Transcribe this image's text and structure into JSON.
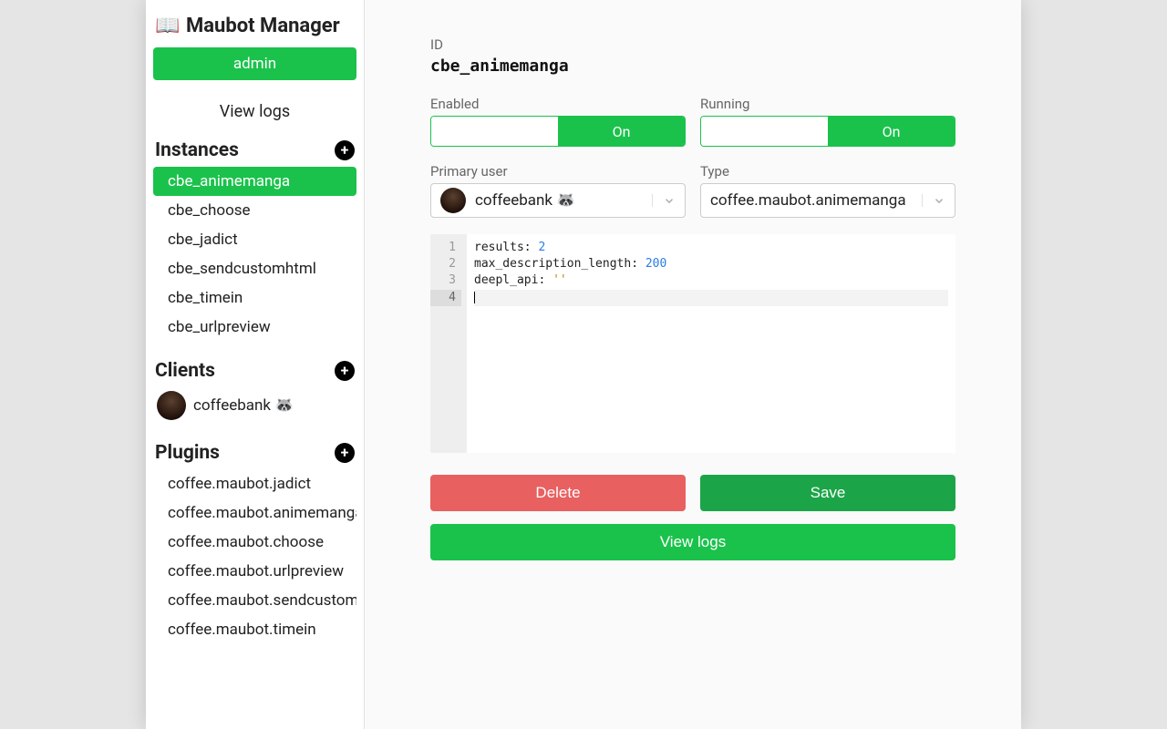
{
  "app": {
    "title": "Maubot Manager"
  },
  "sidebar": {
    "user_badge": "admin",
    "view_logs": "View logs",
    "sections": {
      "instances": {
        "title": "Instances"
      },
      "clients": {
        "title": "Clients"
      },
      "plugins": {
        "title": "Plugins"
      }
    },
    "instances": [
      "cbe_animemanga",
      "cbe_choose",
      "cbe_jadict",
      "cbe_sendcustomhtml",
      "cbe_timein",
      "cbe_urlpreview"
    ],
    "clients": [
      {
        "name": "coffeebank 🦝"
      }
    ],
    "plugins": [
      "coffee.maubot.jadict",
      "coffee.maubot.animemanga",
      "coffee.maubot.choose",
      "coffee.maubot.urlpreview",
      "coffee.maubot.sendcustomht",
      "coffee.maubot.timein"
    ]
  },
  "main": {
    "id_label": "ID",
    "id_value": "cbe_animemanga",
    "enabled": {
      "label": "Enabled",
      "value": "On"
    },
    "running": {
      "label": "Running",
      "value": "On"
    },
    "primary_user": {
      "label": "Primary user",
      "value": "coffeebank 🦝"
    },
    "type": {
      "label": "Type",
      "value": "coffee.maubot.animemanga"
    },
    "config_lines": [
      {
        "key": "results",
        "value": "2",
        "vtype": "num"
      },
      {
        "key": "max_description_length",
        "value": "200",
        "vtype": "num"
      },
      {
        "key": "deepl_api",
        "value": "''",
        "vtype": "str"
      }
    ],
    "buttons": {
      "delete": "Delete",
      "save": "Save",
      "view_logs": "View logs"
    }
  }
}
